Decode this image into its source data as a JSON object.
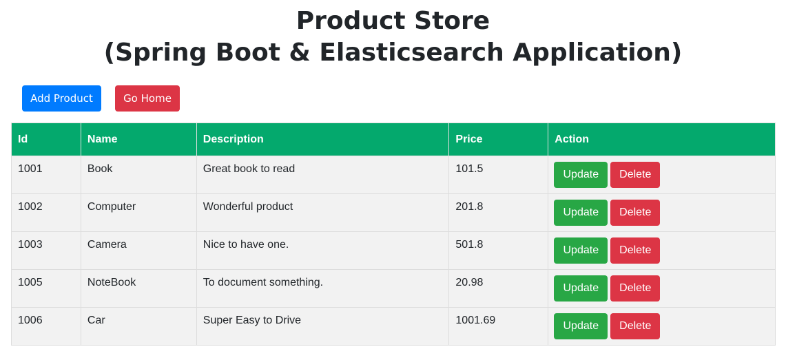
{
  "header": {
    "title_line1": "Product Store",
    "title_line2": "(Spring Boot & Elasticsearch Application)"
  },
  "toolbar": {
    "add_label": "Add Product",
    "home_label": "Go Home"
  },
  "table": {
    "columns": [
      "Id",
      "Name",
      "Description",
      "Price",
      "Action"
    ],
    "rows": [
      {
        "id": "1001",
        "name": "Book",
        "description": "Great book to read",
        "price": "101.5"
      },
      {
        "id": "1002",
        "name": "Computer",
        "description": "Wonderful product",
        "price": "201.8"
      },
      {
        "id": "1003",
        "name": "Camera",
        "description": "Nice to have one.",
        "price": "501.8"
      },
      {
        "id": "1005",
        "name": "NoteBook",
        "description": "To document something.",
        "price": "20.98"
      },
      {
        "id": "1006",
        "name": "Car",
        "description": "Super Easy to Drive",
        "price": "1001.69"
      }
    ],
    "update_label": "Update",
    "delete_label": "Delete"
  },
  "colors": {
    "primary": "#007bff",
    "danger": "#dc3545",
    "success": "#28a745",
    "table_header": "#04a96d",
    "row_background": "#f2f2f2"
  }
}
